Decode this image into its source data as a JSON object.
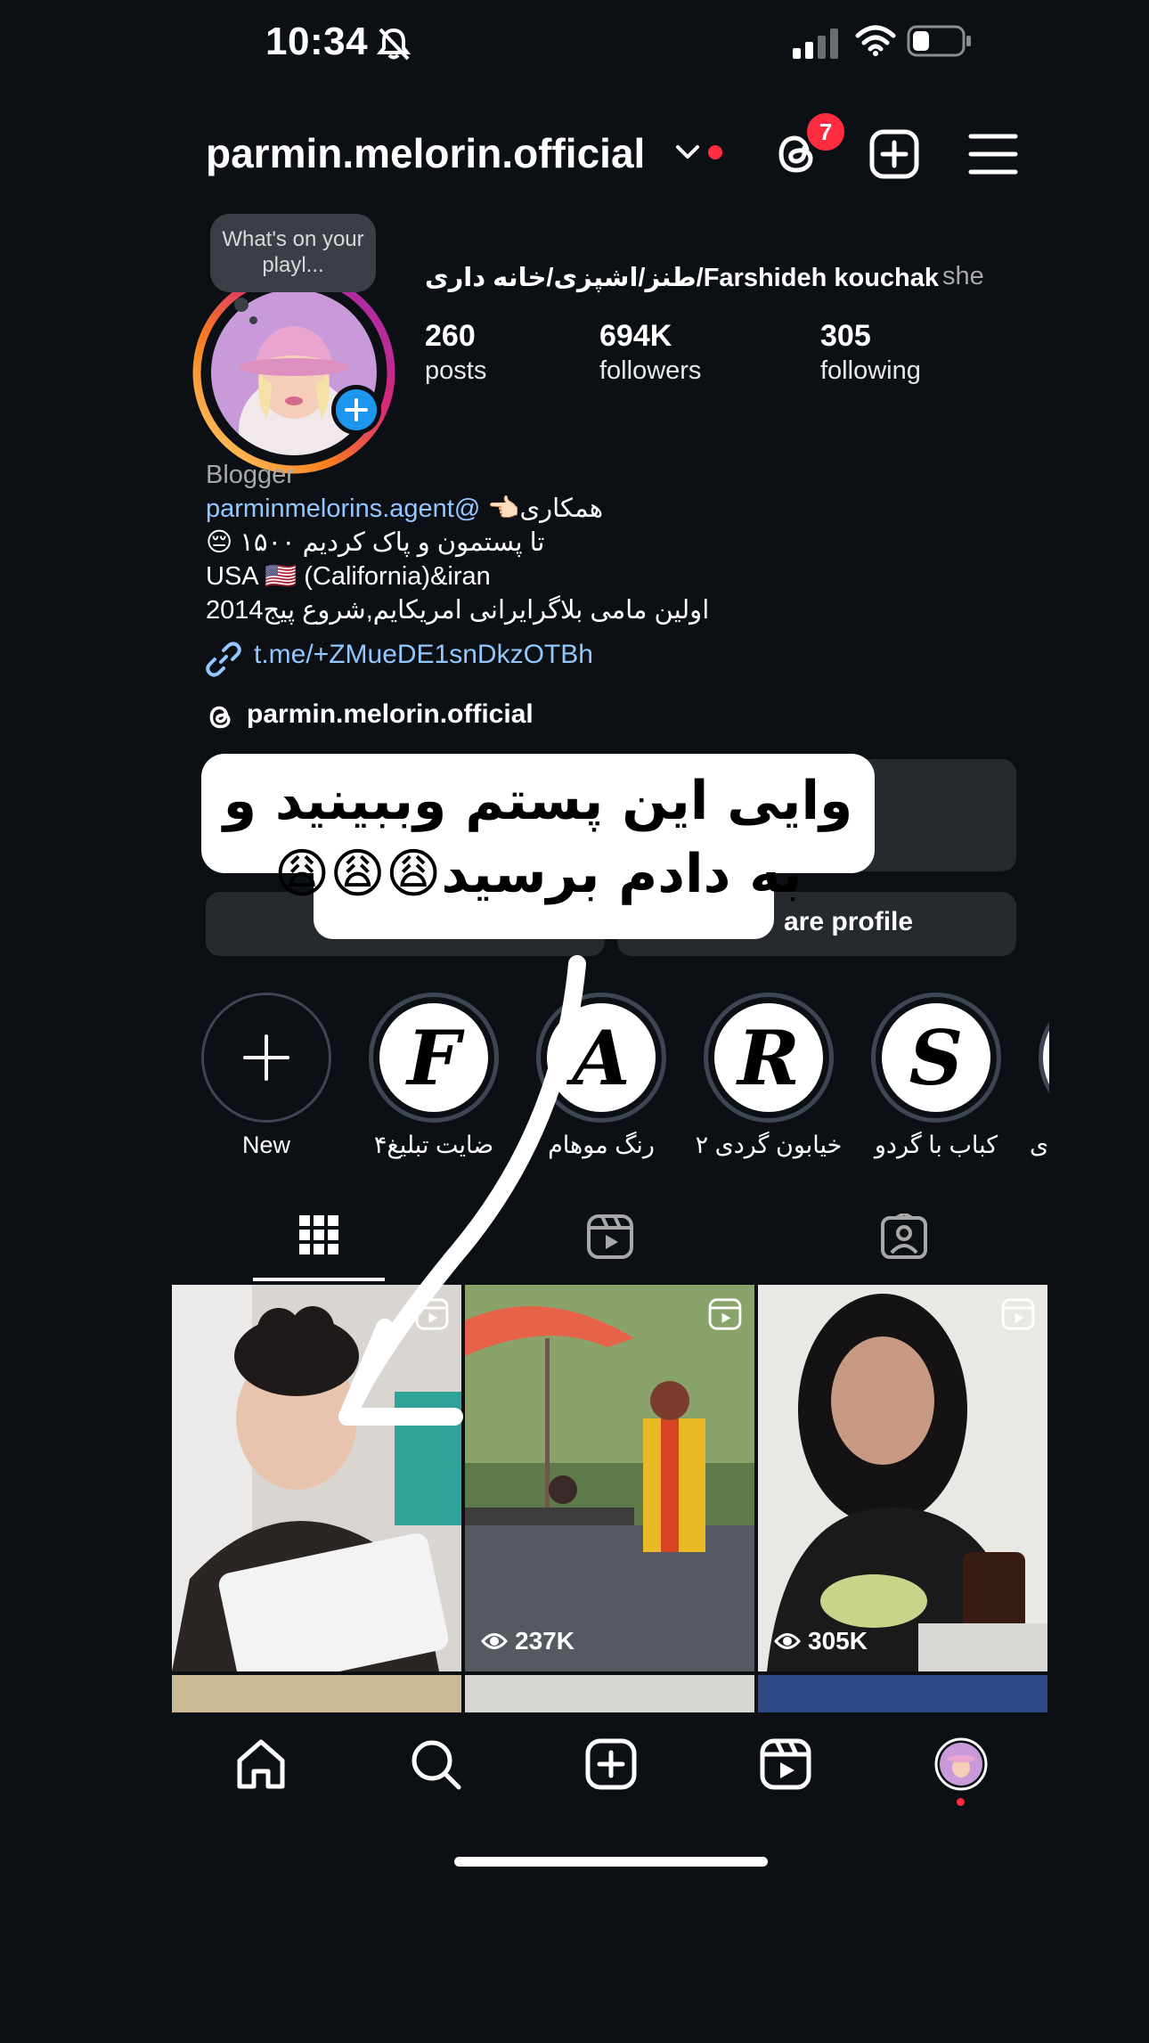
{
  "status_bar": {
    "time": "10:34"
  },
  "header": {
    "username": "parmin.melorin.official",
    "notification_count": "7"
  },
  "profile": {
    "tooltip": "What's on your playl...",
    "full_name": "طنز/اشپزی/خانه داری/Farshideh kouchak",
    "pronouns": "she",
    "stats": [
      {
        "value": "260",
        "label": "posts"
      },
      {
        "value": "694K",
        "label": "followers"
      },
      {
        "value": "305",
        "label": "following"
      }
    ],
    "category": "Blogger",
    "bio_mention": "parminmelorins.agent@",
    "bio_line1_rest": " 👈🏻همکاری",
    "bio_line2": "😔 ۱۵۰۰ تا پستمون و پاک کردیم",
    "bio_line3": "USA 🇺🇸 (California)&iran",
    "bio_line4": "اولین مامی بلاگرایرانی امریکایم,شروع پیج2014",
    "link": "t.me/+ZMueDE1snDkzOTBh",
    "threads_handle": "parmin.melorin.official"
  },
  "buttons": {
    "share_profile_visible": "are profile"
  },
  "sticker": {
    "text": "وایی این پستم وببینید و به دادم برسید😩😩😩"
  },
  "highlights": [
    {
      "label": "New",
      "letter": "+"
    },
    {
      "label": "ضایت تبلیغ۴",
      "letter": "F"
    },
    {
      "label": "رنگ موهام",
      "letter": "A"
    },
    {
      "label": "خیابون گردی ۲",
      "letter": "R"
    },
    {
      "label": "کباب با گردو",
      "letter": "S"
    },
    {
      "label": "ی",
      "letter": ""
    }
  ],
  "grid": [
    {
      "views": ""
    },
    {
      "views": "237K"
    },
    {
      "views": "305K"
    }
  ],
  "colors": {
    "background": "#0c1014",
    "accent_link": "#93c7ff",
    "badge": "#ff2b40",
    "button_bg": "#262a2f"
  },
  "icons": [
    "threads-icon",
    "create-icon",
    "menu-icon",
    "grid-icon",
    "reels-icon",
    "tagged-icon",
    "home-icon",
    "search-icon",
    "reels-nav-icon"
  ]
}
